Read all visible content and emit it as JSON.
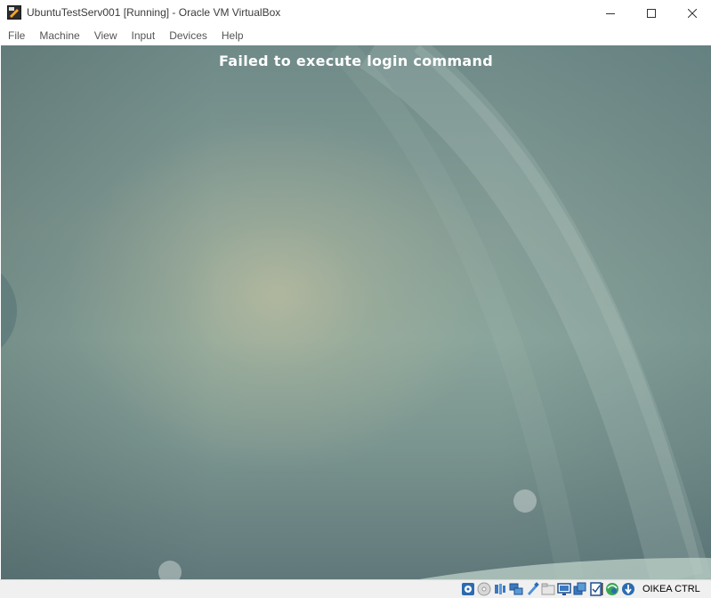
{
  "window": {
    "title": "UbuntuTestServ001 [Running] - Oracle VM VirtualBox",
    "app_icon": "virtualbox-icon",
    "controls": [
      "minimize-icon",
      "maximize-icon",
      "close-icon"
    ]
  },
  "menu": {
    "items": [
      {
        "label": "File"
      },
      {
        "label": "Machine"
      },
      {
        "label": "View"
      },
      {
        "label": "Input"
      },
      {
        "label": "Devices"
      },
      {
        "label": "Help"
      }
    ]
  },
  "vm": {
    "message": "Failed to execute login command",
    "background_accent": "#849c95"
  },
  "statusbar": {
    "icons": [
      "hard-disk-icon",
      "optical-drive-icon",
      "audio-icon",
      "network-icon",
      "usb-icon",
      "shared-folders-icon",
      "display-icon",
      "video-capture-icon",
      "cpu-icon",
      "guest-additions-icon",
      "mouse-integration-icon",
      "keyboard-capture-icon"
    ],
    "host_key": "OIKEA CTRL"
  }
}
